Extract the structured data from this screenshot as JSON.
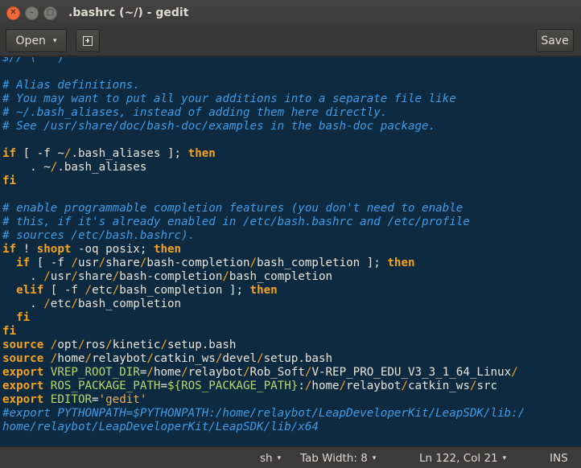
{
  "window": {
    "title": ".bashrc (~/) - gedit",
    "close_glyph": "✕",
    "minimize_glyph": "–",
    "maximize_glyph": "□"
  },
  "toolbar": {
    "open_label": "Open",
    "open_caret": "▾",
    "new_tab_icon": "new-document-icon",
    "save_label": "Save"
  },
  "editor": {
    "lines": [
      [
        [
          "cm",
          "$// \\ '`) '"
        ]
      ],
      [],
      [
        [
          "cm",
          "# Alias definitions."
        ]
      ],
      [
        [
          "cm",
          "# You may want to put all your additions into a separate file like"
        ]
      ],
      [
        [
          "cm",
          "# ~/.bash_aliases, instead of adding them here directly."
        ]
      ],
      [
        [
          "cm",
          "# See /usr/share/doc/bash-doc/examples in the bash-doc package."
        ]
      ],
      [],
      [
        [
          "kw",
          "if"
        ],
        [
          "t",
          " [ -f ~"
        ],
        [
          "sl",
          "/"
        ],
        [
          "t",
          ".bash_aliases ]; "
        ],
        [
          "kw",
          "then"
        ]
      ],
      [
        [
          "t",
          "    . ~"
        ],
        [
          "sl",
          "/"
        ],
        [
          "t",
          ".bash_aliases"
        ]
      ],
      [
        [
          "kw",
          "fi"
        ]
      ],
      [],
      [
        [
          "cm",
          "# enable programmable completion features (you don't need to enable"
        ]
      ],
      [
        [
          "cm",
          "# this, if it's already enabled in /etc/bash.bashrc and /etc/profile"
        ]
      ],
      [
        [
          "cm",
          "# sources /etc/bash.bashrc)."
        ]
      ],
      [
        [
          "kw",
          "if"
        ],
        [
          "t",
          " ! "
        ],
        [
          "kw",
          "shopt"
        ],
        [
          "t",
          " -oq posix; "
        ],
        [
          "kw",
          "then"
        ]
      ],
      [
        [
          "t",
          "  "
        ],
        [
          "kw",
          "if"
        ],
        [
          "t",
          " [ -f "
        ],
        [
          "sl",
          "/"
        ],
        [
          "t",
          "usr"
        ],
        [
          "sl",
          "/"
        ],
        [
          "t",
          "share"
        ],
        [
          "sl",
          "/"
        ],
        [
          "t",
          "bash-completion"
        ],
        [
          "sl",
          "/"
        ],
        [
          "t",
          "bash_completion ]; "
        ],
        [
          "kw",
          "then"
        ]
      ],
      [
        [
          "t",
          "    . "
        ],
        [
          "sl",
          "/"
        ],
        [
          "t",
          "usr"
        ],
        [
          "sl",
          "/"
        ],
        [
          "t",
          "share"
        ],
        [
          "sl",
          "/"
        ],
        [
          "t",
          "bash-completion"
        ],
        [
          "sl",
          "/"
        ],
        [
          "t",
          "bash_completion"
        ]
      ],
      [
        [
          "t",
          "  "
        ],
        [
          "kw",
          "elif"
        ],
        [
          "t",
          " [ -f "
        ],
        [
          "sl",
          "/"
        ],
        [
          "t",
          "etc"
        ],
        [
          "sl",
          "/"
        ],
        [
          "t",
          "bash_completion ]; "
        ],
        [
          "kw",
          "then"
        ]
      ],
      [
        [
          "t",
          "    . "
        ],
        [
          "sl",
          "/"
        ],
        [
          "t",
          "etc"
        ],
        [
          "sl",
          "/"
        ],
        [
          "t",
          "bash_completion"
        ]
      ],
      [
        [
          "t",
          "  "
        ],
        [
          "kw",
          "fi"
        ]
      ],
      [
        [
          "kw",
          "fi"
        ]
      ],
      [
        [
          "kw",
          "source"
        ],
        [
          "t",
          " "
        ],
        [
          "sl",
          "/"
        ],
        [
          "t",
          "opt"
        ],
        [
          "sl",
          "/"
        ],
        [
          "t",
          "ros"
        ],
        [
          "sl",
          "/"
        ],
        [
          "t",
          "kinetic"
        ],
        [
          "sl",
          "/"
        ],
        [
          "t",
          "setup.bash"
        ]
      ],
      [
        [
          "kw",
          "source"
        ],
        [
          "t",
          " "
        ],
        [
          "sl",
          "/"
        ],
        [
          "t",
          "home"
        ],
        [
          "sl",
          "/"
        ],
        [
          "t",
          "relaybot"
        ],
        [
          "sl",
          "/"
        ],
        [
          "t",
          "catkin_ws"
        ],
        [
          "sl",
          "/"
        ],
        [
          "t",
          "devel"
        ],
        [
          "sl",
          "/"
        ],
        [
          "t",
          "setup.bash"
        ]
      ],
      [
        [
          "kw",
          "export"
        ],
        [
          "t",
          " "
        ],
        [
          "var",
          "VREP_ROOT_DIR"
        ],
        [
          "t",
          "="
        ],
        [
          "sl",
          "/"
        ],
        [
          "t",
          "home"
        ],
        [
          "sl",
          "/"
        ],
        [
          "t",
          "relaybot"
        ],
        [
          "sl",
          "/"
        ],
        [
          "t",
          "Rob_Soft"
        ],
        [
          "sl",
          "/"
        ],
        [
          "t",
          "V-REP_PRO_EDU_V3_3_1_64_Linux"
        ],
        [
          "sl",
          "/"
        ]
      ],
      [
        [
          "kw",
          "export"
        ],
        [
          "t",
          " "
        ],
        [
          "var",
          "ROS_PACKAGE_PATH"
        ],
        [
          "t",
          "="
        ],
        [
          "var",
          "${ROS_PACKAGE_PATH}"
        ],
        [
          "t",
          ":"
        ],
        [
          "sl",
          "/"
        ],
        [
          "t",
          "home"
        ],
        [
          "sl",
          "/"
        ],
        [
          "t",
          "relaybot"
        ],
        [
          "sl",
          "/"
        ],
        [
          "t",
          "catkin_ws"
        ],
        [
          "sl",
          "/"
        ],
        [
          "t",
          "src"
        ]
      ],
      [
        [
          "kw",
          "export"
        ],
        [
          "t",
          " "
        ],
        [
          "var",
          "EDITOR"
        ],
        [
          "t",
          "="
        ],
        [
          "str",
          "'gedit'"
        ]
      ],
      [
        [
          "cm",
          "#export PYTHONPATH=$PYTHONPATH:/home/relaybot/LeapDeveloperKit/LeapSDK/lib:/"
        ]
      ],
      [
        [
          "cm",
          "home/relaybot/LeapDeveloperKit/LeapSDK/lib/x64"
        ]
      ]
    ]
  },
  "statusbar": {
    "language": "sh",
    "tab_width": "Tab Width: 8",
    "position": "Ln 122, Col 21",
    "mode": "INS",
    "dropdown_glyph": "▾"
  }
}
